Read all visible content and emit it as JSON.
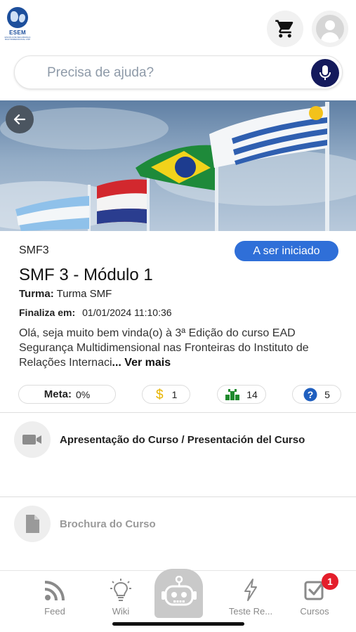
{
  "header": {
    "logo_text": "ESEM",
    "logo_subtitle": "ESCOLA DE SEGURANÇA MULTIDIMENSIONAL USP",
    "cart_icon": "cart-icon",
    "avatar_icon": "user-avatar-icon"
  },
  "search": {
    "placeholder": "Precisa de ajuda?",
    "mic_icon": "microphone-icon"
  },
  "banner": {
    "back_icon": "arrow-left-icon"
  },
  "course": {
    "code": "SMF3",
    "status": "A ser iniciado",
    "title": "SMF 3 - Módulo 1",
    "turma_label": "Turma:",
    "turma_value": "Turma SMF",
    "finaliza_label": "Finaliza em:",
    "finaliza_value": "01/01/2024 11:10:36",
    "description": "Olá, seja muito bem vinda(o) à 3ª Edição do curso EAD Segurança Multidimensional nas Fronteiras do Instituto de Relações Internaci",
    "more_label": "... Ver mais"
  },
  "stats": {
    "meta_label": "Meta:",
    "meta_value": "0%",
    "coins_value": "1",
    "blocks_value": "14",
    "questions_value": "5"
  },
  "lessons": [
    {
      "title": "Apresentação do Curso / Presentación del Curso",
      "icon": "video-camera-icon",
      "color": "#222222"
    },
    {
      "title": "Brochura do Curso",
      "icon": "document-icon",
      "color": "#9a9a9a"
    }
  ],
  "nav": {
    "items": [
      {
        "label": "Feed",
        "icon": "rss-feed-icon"
      },
      {
        "label": "Wiki",
        "icon": "lightbulb-icon"
      },
      {
        "label": "",
        "icon": "robot-icon"
      },
      {
        "label": "Teste Re...",
        "icon": "lightning-icon"
      },
      {
        "label": "Cursos",
        "icon": "checkbox-icon"
      }
    ],
    "cursos_badge": "1"
  },
  "colors": {
    "accent_blue": "#2f6fd8",
    "mic_navy": "#141a5c",
    "badge_red": "#e41e2b",
    "coin_gold": "#e8b400",
    "blocks_green": "#1f8a2e",
    "question_blue": "#1f5fbf"
  }
}
